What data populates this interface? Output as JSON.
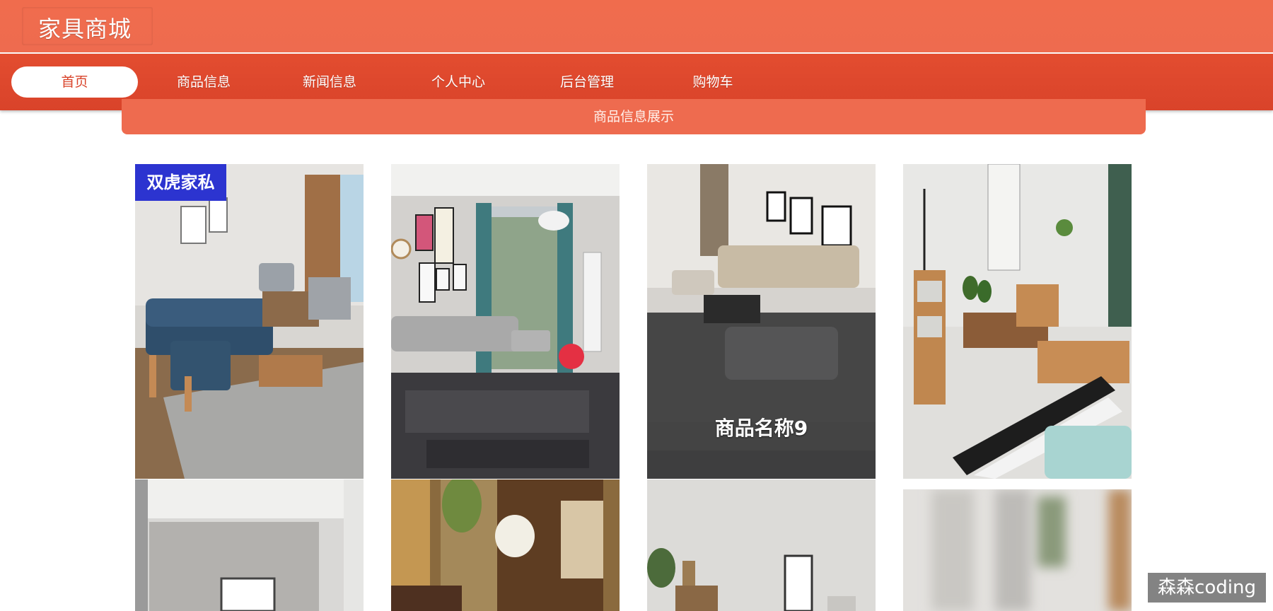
{
  "header": {
    "site_title": "家具商城"
  },
  "nav": {
    "items": [
      {
        "label": "首页",
        "active": true
      },
      {
        "label": "商品信息",
        "active": false
      },
      {
        "label": "新闻信息",
        "active": false
      },
      {
        "label": "个人中心",
        "active": false
      },
      {
        "label": "后台管理",
        "active": false
      },
      {
        "label": "购物车",
        "active": false
      }
    ]
  },
  "section": {
    "title": "商品信息展示"
  },
  "products": [
    {
      "badge": "双虎家私",
      "name": "",
      "image": "living-room-blue-sofa"
    },
    {
      "badge": "",
      "name": "",
      "image": "living-room-grey-sofa"
    },
    {
      "badge": "",
      "name": "商品名称9",
      "image": "living-room-sectional-sofa"
    },
    {
      "badge": "",
      "name": "",
      "image": "tv-cabinet-set"
    },
    {
      "badge": "",
      "name": "",
      "image": "white-wall-room"
    },
    {
      "badge": "",
      "name": "",
      "image": "dining-room-flowers"
    },
    {
      "badge": "",
      "name": "",
      "image": "white-room-cabinet"
    },
    {
      "badge": "",
      "name": "",
      "image": "blurred-room"
    }
  ],
  "watermark": "森森coding",
  "colors": {
    "header": "#ee6b4f",
    "nav": "#d9432a",
    "badge": "#2c34d0"
  }
}
